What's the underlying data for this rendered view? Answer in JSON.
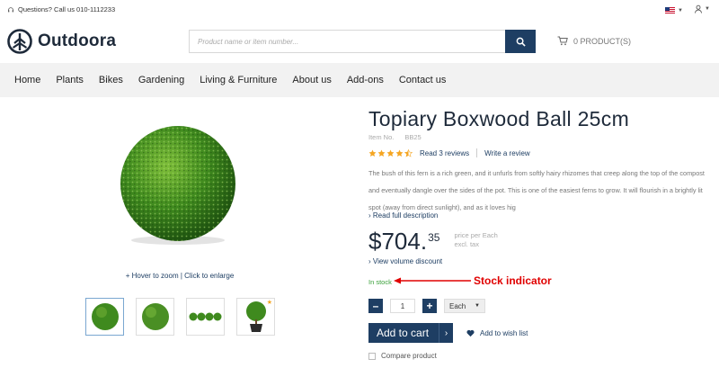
{
  "topbar": {
    "help_text": "Questions? Call us 010-1112233"
  },
  "header": {
    "logo_text": "Outdoora",
    "search_placeholder": "Product name or item number...",
    "cart_text": "0 PRODUCT(S)"
  },
  "nav": {
    "items": [
      "Home",
      "Plants",
      "Bikes",
      "Gardening",
      "Living & Furniture",
      "About us",
      "Add-ons",
      "Contact us"
    ]
  },
  "gallery": {
    "zoom_hint": "+ Hover to zoom | Click to enlarge"
  },
  "product": {
    "title": "Topiary Boxwood Ball 25cm",
    "item_no_label": "Item No.",
    "item_no": "BB25",
    "rating": 4.5,
    "reviews_link": "Read 3 reviews",
    "write_review": "Write a review",
    "description": "The bush of this fern is a rich green, and it unfurls from softly hairy rhizomes that creep along the top of the compost and eventually dangle over the sides of the pot. This is one of the easiest ferns to grow. It will flourish in a brightly lit spot (away from direct sunlight), and as it loves hig",
    "read_full": "› Read full description",
    "price_main": "$704.",
    "price_cents": "35",
    "price_per": "price per Each",
    "price_tax": "excl. tax",
    "volume_discount": "› View volume discount",
    "stock": "In stock",
    "quantity": "1",
    "uom": "Each",
    "add_to_cart": "Add to cart",
    "wishlist": "Add to wish list",
    "compare": "Compare product"
  },
  "annotation": {
    "label": "Stock indicator",
    "color": "#e00000"
  },
  "colors": {
    "brand": "#1e3e63",
    "star": "#f5a623",
    "instock": "#3aa03a"
  }
}
